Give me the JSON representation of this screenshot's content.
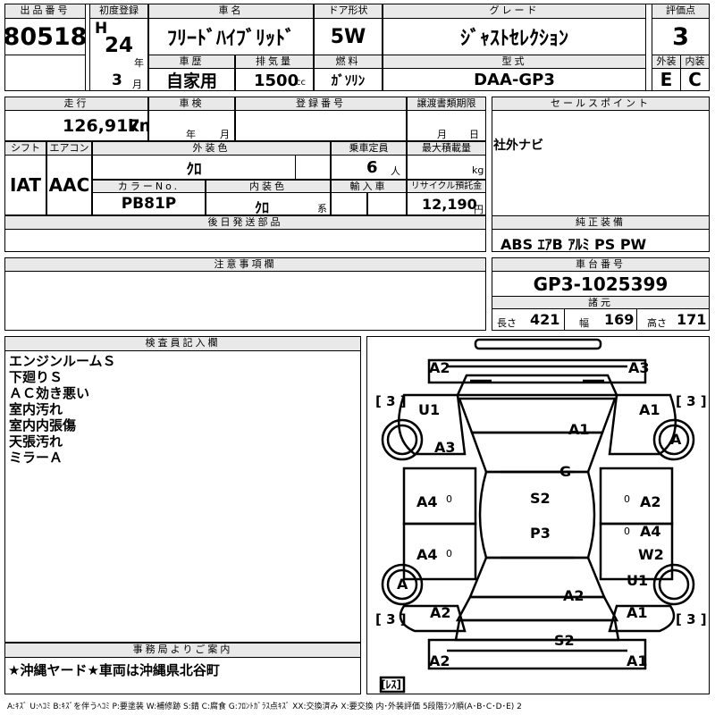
{
  "header": {
    "lot_label": "出品番号",
    "lot_no": "80518",
    "first_reg_label": "初度登録",
    "era": "H",
    "year": "24",
    "year_unit": "年",
    "month": "3",
    "month_unit": "月",
    "car_name_label": "車名",
    "car_name": "ﾌﾘｰﾄﾞﾊｲﾌﾞﾘｯﾄﾞ",
    "door_label": "ドア形状",
    "door": "5W",
    "grade_label": "グレード",
    "grade": "ｼﾞｬｽﾄｾﾚｸｼｮﾝ",
    "score_label": "評価点",
    "score": "3",
    "history_label": "車歴",
    "history": "自家用",
    "displacement_label": "排気量",
    "displacement": "1500",
    "displacement_unit": "cc",
    "fuel_label": "燃料",
    "fuel": "ｶﾞｿﾘﾝ",
    "model_label": "型式",
    "model": "DAA-GP3",
    "ext_label": "外装",
    "ext": "E",
    "int_label": "内装",
    "int": "C"
  },
  "details": {
    "mileage_label": "走行",
    "mileage": "126,917",
    "mileage_unit": "km",
    "inspection_label": "車検",
    "insp_year_unit": "年",
    "insp_month_unit": "月",
    "reg_label": "登録番号",
    "transfer_label": "譲渡書類期限",
    "transfer_month_unit": "月",
    "transfer_day_unit": "日",
    "shift_label": "シフト",
    "shift": "IAT",
    "ac_label": "エアコン",
    "ac": "AAC",
    "ext_color_label": "外装色",
    "ext_color": "ｸﾛ",
    "capacity_label": "乗車定員",
    "capacity": "6",
    "capacity_unit": "人",
    "load_label": "最大積載量",
    "load_unit": "kg",
    "color_no_label": "カラーNo.",
    "color_no": "PB81P",
    "int_color_label": "内装色",
    "int_color": "ｸﾛ",
    "int_color_unit": "系",
    "import_label": "輸入車",
    "recycle_label": "リサイクル預託金",
    "recycle": "12,190",
    "recycle_unit": "円",
    "later_parts_label": "後日発送部品",
    "notes_label": "注意事項欄"
  },
  "sales": {
    "label": "セールスポイント",
    "text": "社外ナビ",
    "equip_label": "純正装備",
    "equip": "ABS ｴｱB ｱﾙﾐ PS PW",
    "chassis_label": "車台番号",
    "chassis": "GP3-1025399",
    "dims_label": "諸元",
    "length_label": "長さ",
    "length": "421",
    "width_label": "幅",
    "width": "169",
    "height_label": "高さ",
    "height": "171"
  },
  "inspector": {
    "label": "検査員記入欄",
    "lines": [
      "エンジンルームＳ",
      "下廻りＳ",
      "ＡＣ効き悪い",
      "室内汚れ",
      "室内内張傷",
      "天張汚れ",
      "ミラーＡ"
    ]
  },
  "office": {
    "label": "事務局よりご案内",
    "text": "★沖縄ヤード★車両は沖縄県北谷町"
  },
  "legend": "A:ｷｽﾞ U:ﾍｺﾐ B:ｷｽﾞを伴うﾍｺﾐ P:要塗装 W:補修跡 S:錆 C:腐食 G:ﾌﾛﾝﾄｶﾞﾗｽ点ｷｽﾞ XX:交換済み X:要交換 内･外装評価 5段階ﾗﾝｸ順(A･B･C･D･E) 2",
  "diagram": {
    "marks": [
      {
        "id": "front-left-corner",
        "text": "A2"
      },
      {
        "id": "front-right-corner",
        "text": "A3"
      },
      {
        "id": "front-left-fender",
        "text": "U1"
      },
      {
        "id": "front-right-fender",
        "text": "A1"
      },
      {
        "id": "bonnet",
        "text": "A1"
      },
      {
        "id": "left-front-door-upper",
        "text": "A3"
      },
      {
        "id": "front-left-wheel",
        "text": "A"
      },
      {
        "id": "windshield",
        "text": "G"
      },
      {
        "id": "roof-front",
        "text": "S2"
      },
      {
        "id": "left-front-door",
        "text": "A4"
      },
      {
        "id": "right-front-door",
        "text": "A2"
      },
      {
        "id": "roof-rear",
        "text": "P3"
      },
      {
        "id": "right-rear-door",
        "text": "A4"
      },
      {
        "id": "right-rear-door-w",
        "text": "W2"
      },
      {
        "id": "left-rear-door",
        "text": "A4"
      },
      {
        "id": "rear-left-wheel",
        "text": "A"
      },
      {
        "id": "rear-right-fender",
        "text": "U1"
      },
      {
        "id": "rear-glass",
        "text": "A2"
      },
      {
        "id": "rear-left-fender",
        "text": "A2"
      },
      {
        "id": "rear-right-fender-low",
        "text": "A1"
      },
      {
        "id": "rear-bumper-center",
        "text": "S2"
      },
      {
        "id": "rear-left-corner",
        "text": "A2"
      },
      {
        "id": "rear-right-corner",
        "text": "A1"
      }
    ],
    "tire_tl": "[ 3 ]",
    "tire_tr": "[ 3 ]",
    "tire_bl": "[ 3 ]",
    "tire_br": "[ 3 ]",
    "spare": "[ﾚｽ]",
    "zero": "0"
  }
}
